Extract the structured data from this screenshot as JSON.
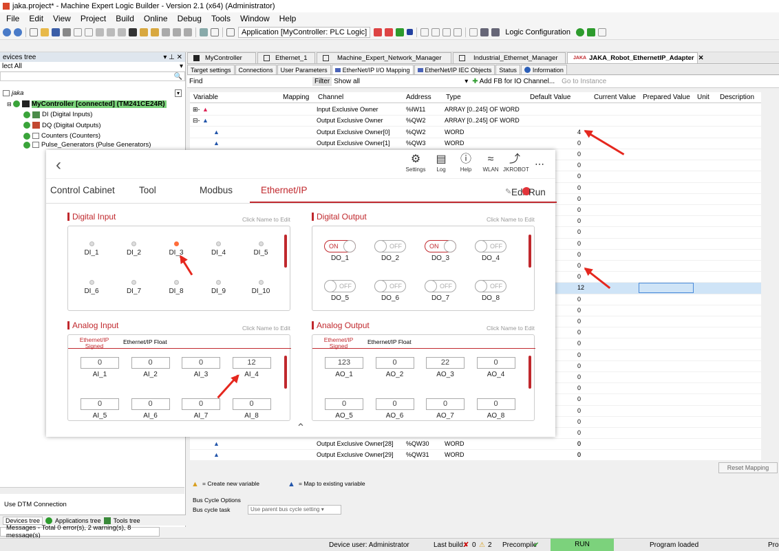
{
  "window": {
    "title": "jaka.project* - Machine Expert Logic Builder - Version 2.1 (x64) (Administrator)"
  },
  "menu": [
    "File",
    "Edit",
    "View",
    "Project",
    "Build",
    "Online",
    "Debug",
    "Tools",
    "Window",
    "Help"
  ],
  "toolbar": {
    "application": "Application [MyController: PLC Logic]",
    "config": "Logic Configuration"
  },
  "devices_tree": {
    "title": "evices tree",
    "filter": "lect All",
    "root": "jaka",
    "controller": "MyController [connected] (TM241CE24R)",
    "items": [
      "DI (Digital Inputs)",
      "DQ (Digital Outputs)",
      "Counters (Counters)",
      "Pulse_Generators (Pulse Generators)"
    ],
    "use_dtm": "Use DTM Connection",
    "bottom_tabs": [
      "Devices tree",
      "Applications tree",
      "Tools tree"
    ],
    "messages": "Messages - Total 0 error(s), 2 warning(s), 8 message(s)"
  },
  "doc_tabs": [
    "MyController",
    "Ethernet_1",
    "Machine_Expert_Network_Manager",
    "Industrial_Ethernet_Manager",
    "JAKA_Robot_EthernetIP_Adapter"
  ],
  "sub_tabs": [
    "Target settings",
    "Connections",
    "User Parameters",
    "EtherNet/IP I/O Mapping",
    "EtherNet/IP IEC Objects",
    "Status",
    "Information"
  ],
  "find": {
    "label": "Find",
    "filter_label": "Filter",
    "filter_value": "Show all",
    "add_fb": "Add FB for IO Channel...",
    "goto": "Go to Instance"
  },
  "grid": {
    "headers": [
      "Variable",
      "Mapping",
      "Channel",
      "Address",
      "Type",
      "Default Value",
      "Current Value",
      "Prepared Value",
      "Unit",
      "Description"
    ],
    "rows": [
      {
        "channel": "Input Exclusive Owner",
        "address": "%IW11",
        "type": "ARRAY [0..245] OF WORD",
        "value": ""
      },
      {
        "channel": "Output Exclusive Owner",
        "address": "%QW2",
        "type": "ARRAY [0..245] OF WORD",
        "value": ""
      },
      {
        "channel": "Output Exclusive Owner[0]",
        "address": "%QW2",
        "type": "WORD",
        "value": "4"
      },
      {
        "channel": "Output Exclusive Owner[1]",
        "address": "%QW3",
        "type": "WORD",
        "value": "0"
      }
    ],
    "values_col": [
      "0",
      "0",
      "0",
      "0",
      "0",
      "0",
      "0",
      "0",
      "0",
      "0",
      "0",
      "0",
      "12",
      "0",
      "0",
      "0",
      "0",
      "0",
      "0",
      "0",
      "0",
      "0",
      "0",
      "0",
      "0",
      "0",
      "0",
      "0",
      "0",
      "0"
    ],
    "tail_rows": [
      {
        "channel": "Output Exclusive Owner[28]",
        "address": "%QW30",
        "type": "WORD",
        "value": "0"
      },
      {
        "channel": "Output Exclusive Owner[29]",
        "address": "%QW31",
        "type": "WORD",
        "value": "0"
      }
    ],
    "reset": "Reset Mapping",
    "legend_new": "= Create new variable",
    "legend_map": "= Map to existing variable",
    "bus_options": "Bus Cycle Options",
    "bus_task_label": "Bus cycle task",
    "bus_task_value": "Use parent bus cycle setting"
  },
  "status": {
    "user": "Device user: Administrator",
    "last_build": "Last build:",
    "errors": "0",
    "warnings": "2",
    "precompile": "Precompile",
    "run": "RUN",
    "program": "Program loaded",
    "cut": "Pro"
  },
  "overlay": {
    "icons": [
      "Settings",
      "Log",
      "Help",
      "WLAN",
      "JKROBOT"
    ],
    "edit": "Edit",
    "run": "Run",
    "tabs": [
      "Control Cabinet",
      "Tool",
      "Modbus",
      "Ethernet/IP"
    ],
    "digital_input": "Digital Input",
    "digital_output": "Digital Output",
    "analog_input": "Analog Input",
    "analog_output": "Analog Output",
    "hint": "Click Name to Edit",
    "ai_tabs": [
      "Ethernet/IP Signed",
      "Ethernet/IP Float"
    ],
    "di": [
      {
        "label": "DI_1",
        "on": false
      },
      {
        "label": "DI_2",
        "on": false
      },
      {
        "label": "DI_3",
        "on": true
      },
      {
        "label": "DI_4",
        "on": false
      },
      {
        "label": "DI_5",
        "on": false
      },
      {
        "label": "DI_6",
        "on": false
      },
      {
        "label": "DI_7",
        "on": false
      },
      {
        "label": "DI_8",
        "on": false
      },
      {
        "label": "DI_9",
        "on": false
      },
      {
        "label": "DI_10",
        "on": false
      }
    ],
    "do": [
      {
        "label": "DO_1",
        "state": "ON"
      },
      {
        "label": "DO_2",
        "state": "OFF"
      },
      {
        "label": "DO_3",
        "state": "ON"
      },
      {
        "label": "DO_4",
        "state": "OFF"
      },
      {
        "label": "DO_5",
        "state": "OFF"
      },
      {
        "label": "DO_6",
        "state": "OFF"
      },
      {
        "label": "DO_7",
        "state": "OFF"
      },
      {
        "label": "DO_8",
        "state": "OFF"
      }
    ],
    "ai": [
      {
        "label": "AI_1",
        "value": "0"
      },
      {
        "label": "AI_2",
        "value": "0"
      },
      {
        "label": "AI_3",
        "value": "0"
      },
      {
        "label": "AI_4",
        "value": "12"
      },
      {
        "label": "AI_5",
        "value": "0"
      },
      {
        "label": "AI_6",
        "value": "0"
      },
      {
        "label": "AI_7",
        "value": "0"
      },
      {
        "label": "AI_8",
        "value": "0"
      }
    ],
    "ao": [
      {
        "label": "AO_1",
        "value": "123"
      },
      {
        "label": "AO_2",
        "value": "0"
      },
      {
        "label": "AO_3",
        "value": "22"
      },
      {
        "label": "AO_4",
        "value": "0"
      },
      {
        "label": "AO_5",
        "value": "0"
      },
      {
        "label": "AO_6",
        "value": "0"
      },
      {
        "label": "AO_7",
        "value": "0"
      },
      {
        "label": "AO_8",
        "value": "0"
      }
    ],
    "accent": "#c0282d"
  }
}
